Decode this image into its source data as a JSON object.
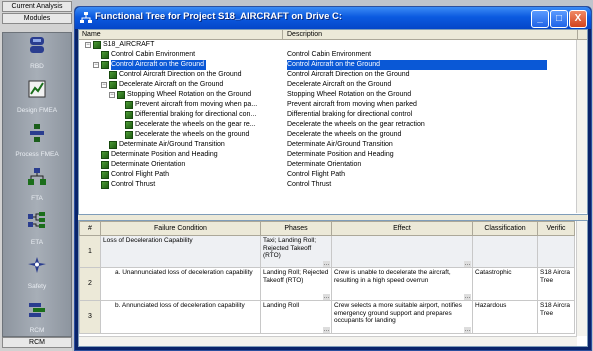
{
  "sidebar": {
    "top_tab": "Current Analysis",
    "modules_header": "Modules",
    "bottom_tab": "RCM",
    "items": [
      {
        "label": "RBD",
        "icon": "rbd-icon"
      },
      {
        "label": "Design FMEA",
        "icon": "design-fmea-icon"
      },
      {
        "label": "Process FMEA",
        "icon": "process-fmea-icon"
      },
      {
        "label": "FTA",
        "icon": "fta-icon"
      },
      {
        "label": "ETA",
        "icon": "eta-icon"
      },
      {
        "label": "Safety",
        "icon": "safety-icon"
      },
      {
        "label": "RCM",
        "icon": "rcm-icon"
      }
    ]
  },
  "window": {
    "title": "Functional Tree for Project S18_AIRCRAFT on Drive C:",
    "title_icon": "tree-icon",
    "min_label": "_",
    "max_label": "□",
    "close_label": "X"
  },
  "tree": {
    "col_name": "Name",
    "col_desc": "Description",
    "rows": [
      {
        "name": "S18_AIRCRAFT",
        "desc": "",
        "level": 0,
        "expander": "−"
      },
      {
        "name": "Control Cabin Environment",
        "desc": "Control Cabin Environment",
        "level": 1,
        "expander": ""
      },
      {
        "name": "Control Aircraft on the Ground",
        "desc": "Control Aircraft on the Ground",
        "level": 1,
        "expander": "−",
        "selected": true
      },
      {
        "name": "Control Aircraft Direction on the Ground",
        "desc": "Control Aircraft Direction on the Ground",
        "level": 2,
        "expander": ""
      },
      {
        "name": "Decelerate Aircraft on the Ground",
        "desc": "Decelerate Aircraft on the Ground",
        "level": 2,
        "expander": "−"
      },
      {
        "name": "Stopping Wheel Rotation on the Ground",
        "desc": "Stopping Wheel Rotation on the Ground",
        "level": 3,
        "expander": "−"
      },
      {
        "name": "Prevent aircraft from moving when pa...",
        "desc": "Prevent aircraft from moving when parked",
        "level": 4,
        "expander": ""
      },
      {
        "name": "Differential braking for directional con...",
        "desc": "Differential braking for directional control",
        "level": 4,
        "expander": ""
      },
      {
        "name": "Decelerate the wheels on the gear re...",
        "desc": "Decelerate the wheels on the gear retraction",
        "level": 4,
        "expander": ""
      },
      {
        "name": "Decelerate the wheels on the ground",
        "desc": "Decelerate the wheels on the ground",
        "level": 4,
        "expander": ""
      },
      {
        "name": "Determinate Air/Ground Transition",
        "desc": "Determinate Air/Ground Transition",
        "level": 2,
        "expander": ""
      },
      {
        "name": "Determinate Position and Heading",
        "desc": "Determinate Position and Heading",
        "level": 1,
        "expander": ""
      },
      {
        "name": "Determinate Orientation",
        "desc": "Determinate Orientation",
        "level": 1,
        "expander": ""
      },
      {
        "name": "Control Flight Path",
        "desc": "Control Flight Path",
        "level": 1,
        "expander": ""
      },
      {
        "name": "Control Thrust",
        "desc": "Control Thrust",
        "level": 1,
        "expander": ""
      }
    ]
  },
  "grid": {
    "headers": [
      "#",
      "Failure Condition",
      "Phases",
      "Effect",
      "Classification",
      "Verific"
    ],
    "rows": [
      {
        "num": "1",
        "failure": "Loss of Deceleration Capability",
        "phases": "Taxi; Landing Roll; Rejected Takeoff (RTO)",
        "effect": "",
        "classification": "",
        "verification": ""
      },
      {
        "num": "2",
        "failure": "a. Unannunciated loss of deceleration capability",
        "phases": "Landing Roll; Rejected Takeoff (RTO)",
        "effect": "Crew is unable to decelerate the aircraft, resulting in a high speed overrun",
        "classification": "Catastrophic",
        "verification": "S18 Aircra Tree"
      },
      {
        "num": "3",
        "failure": "b. Annunciated loss of deceleration capability",
        "phases": "Landing Roll",
        "effect": "Crew selects a more suitable airport, notifies emergency ground support and prepares occupants for landing",
        "classification": "Hazardous",
        "verification": "S18 Aircra Tree"
      }
    ]
  }
}
